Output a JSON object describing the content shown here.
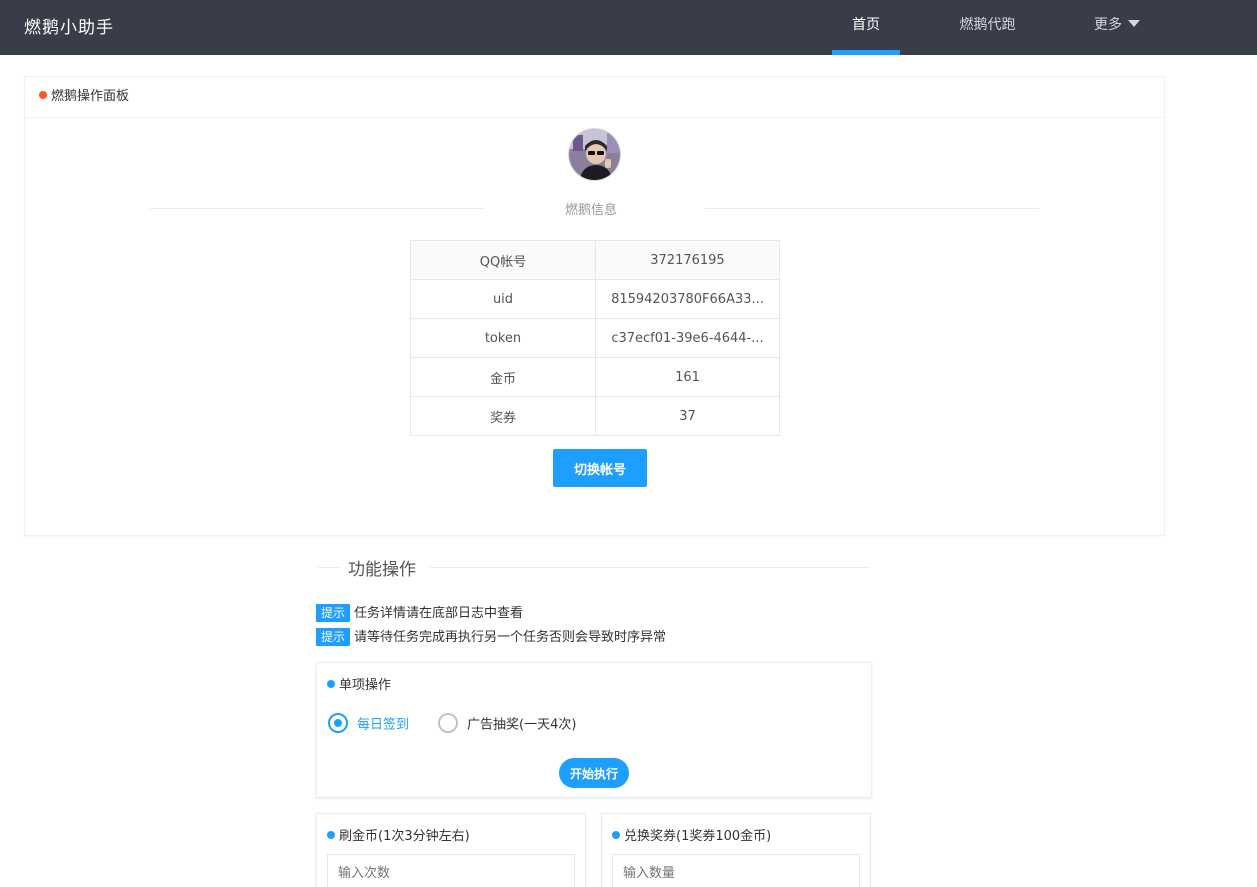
{
  "header": {
    "brand": "燃鹅小助手",
    "nav": {
      "home": "首页",
      "run": "燃鹅代跑",
      "more": "更多"
    }
  },
  "panel": {
    "title": "燃鹅操作面板",
    "info_label": "燃鹅信息",
    "rows": [
      {
        "key": "QQ帐号",
        "value": "372176195"
      },
      {
        "key": "uid",
        "value": "81594203780F66A33..."
      },
      {
        "key": "token",
        "value": "c37ecf01-39e6-4644-..."
      },
      {
        "key": "金币",
        "value": "161"
      },
      {
        "key": "奖券",
        "value": "37"
      }
    ],
    "switch_button": "切换帐号"
  },
  "functions": {
    "title": "功能操作",
    "tips": [
      {
        "tag": "提示",
        "text": "任务详情请在底部日志中查看"
      },
      {
        "tag": "提示",
        "text": "请等待任务完成再执行另一个任务否则会导致时序异常"
      }
    ],
    "single": {
      "title": "单项操作",
      "options": [
        {
          "label": "每日签到",
          "checked": true
        },
        {
          "label": "广告抽奖(一天4次)",
          "checked": false
        }
      ],
      "run_button": "开始执行"
    },
    "coins": {
      "title": "刷金币(1次3分钟左右)",
      "placeholder": "输入次数"
    },
    "exchange": {
      "title": "兑换奖券(1奖券100金币)",
      "placeholder": "输入数量"
    }
  },
  "colors": {
    "header_bg": "#393d49",
    "accent": "#1e9fff",
    "panel_dot": "#ff5722"
  }
}
